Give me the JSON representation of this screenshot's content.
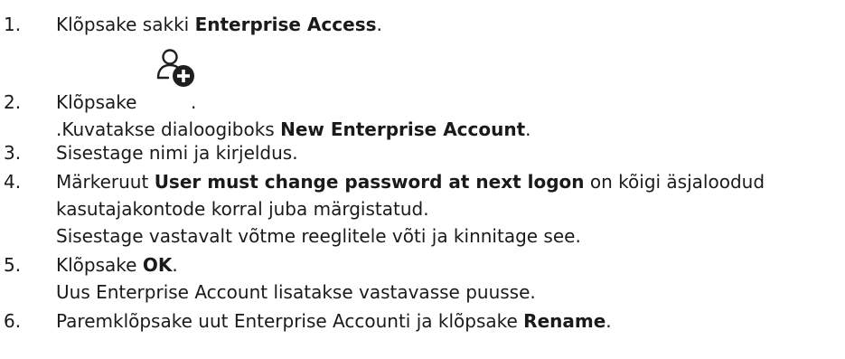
{
  "steps": [
    {
      "number": "1.",
      "text_before": "Klõpsake sakki ",
      "bold": "Enterprise Access",
      "text_after": "."
    },
    {
      "number": "2.",
      "text_before": "Klõpsake",
      "icon": "add-user-icon",
      "text_after": ".",
      "sub_before": ".Kuvatakse dialoogiboks ",
      "sub_bold": "New Enterprise Account",
      "sub_after": "."
    },
    {
      "number": "3.",
      "text": "Sisestage nimi ja kirjeldus."
    },
    {
      "number": "4.",
      "text_before": "Märkeruut ",
      "bold": "User must change password at next logon",
      "text_after": " on kõigi äsjaloodud",
      "line2": "kasutajakontode korral juba märgistatud.",
      "line3": "Sisestage vastavalt võtme reeglitele võti ja kinnitage see."
    },
    {
      "number": "5.",
      "text_before": "Klõpsake ",
      "bold": "OK",
      "text_after": ".",
      "line2": "Uus Enterprise Account lisatakse vastavasse puusse."
    },
    {
      "number": "6.",
      "text_before": "Paremklõpsake uut Enterprise Accounti ja klõpsake ",
      "bold": "Rename",
      "text_after": "."
    }
  ]
}
